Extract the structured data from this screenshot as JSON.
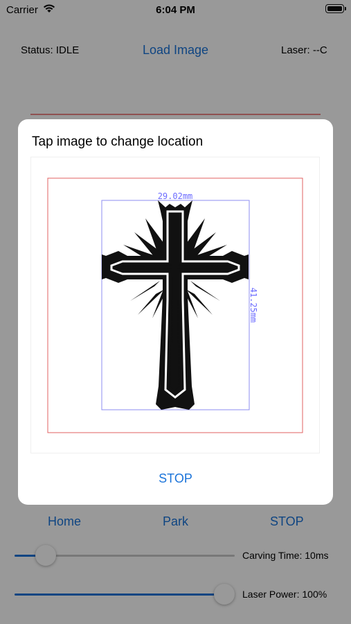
{
  "status_bar": {
    "carrier": "Carrier",
    "time": "6:04 PM"
  },
  "top_bar": {
    "status_label": "Status: IDLE",
    "load_image_label": "Load Image",
    "laser_label": "Laser: --C"
  },
  "controls": {
    "home_label": "Home",
    "park_label": "Park",
    "stop_label": "STOP"
  },
  "sliders": {
    "carving_time": {
      "label": "Carving Time: 10ms",
      "value": 0.13
    },
    "laser_power": {
      "label": "Laser Power: 100%",
      "value": 1.0
    }
  },
  "dialog": {
    "title": "Tap image to change location",
    "width_dimension": "29.02mm",
    "height_dimension": "41.25mm",
    "stop_label": "STOP"
  },
  "colors": {
    "accent": "#1a73d9",
    "bounds_red": "#e06060",
    "dimension_blue": "#6b6bff",
    "dim_overlay": "rgba(0,0,0,0.40)"
  }
}
